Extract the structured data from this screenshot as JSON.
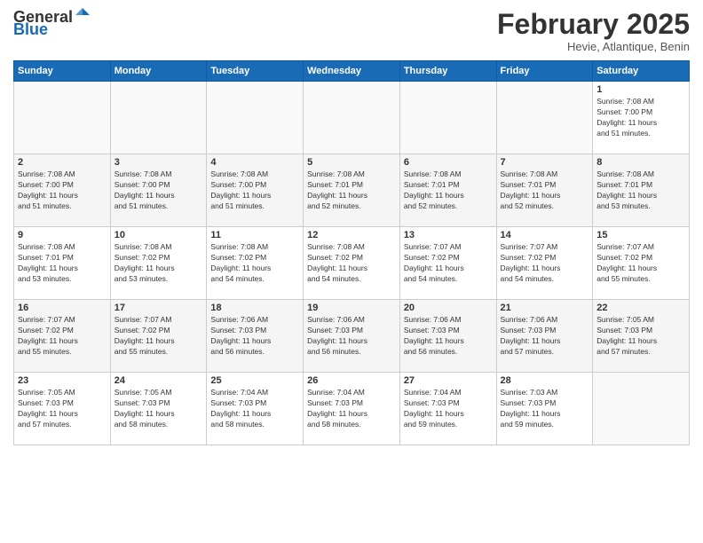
{
  "header": {
    "logo_general": "General",
    "logo_blue": "Blue",
    "month_title": "February 2025",
    "location": "Hevie, Atlantique, Benin"
  },
  "days_of_week": [
    "Sunday",
    "Monday",
    "Tuesday",
    "Wednesday",
    "Thursday",
    "Friday",
    "Saturday"
  ],
  "weeks": [
    [
      {
        "day": "",
        "info": ""
      },
      {
        "day": "",
        "info": ""
      },
      {
        "day": "",
        "info": ""
      },
      {
        "day": "",
        "info": ""
      },
      {
        "day": "",
        "info": ""
      },
      {
        "day": "",
        "info": ""
      },
      {
        "day": "1",
        "info": "Sunrise: 7:08 AM\nSunset: 7:00 PM\nDaylight: 11 hours\nand 51 minutes."
      }
    ],
    [
      {
        "day": "2",
        "info": "Sunrise: 7:08 AM\nSunset: 7:00 PM\nDaylight: 11 hours\nand 51 minutes."
      },
      {
        "day": "3",
        "info": "Sunrise: 7:08 AM\nSunset: 7:00 PM\nDaylight: 11 hours\nand 51 minutes."
      },
      {
        "day": "4",
        "info": "Sunrise: 7:08 AM\nSunset: 7:00 PM\nDaylight: 11 hours\nand 51 minutes."
      },
      {
        "day": "5",
        "info": "Sunrise: 7:08 AM\nSunset: 7:01 PM\nDaylight: 11 hours\nand 52 minutes."
      },
      {
        "day": "6",
        "info": "Sunrise: 7:08 AM\nSunset: 7:01 PM\nDaylight: 11 hours\nand 52 minutes."
      },
      {
        "day": "7",
        "info": "Sunrise: 7:08 AM\nSunset: 7:01 PM\nDaylight: 11 hours\nand 52 minutes."
      },
      {
        "day": "8",
        "info": "Sunrise: 7:08 AM\nSunset: 7:01 PM\nDaylight: 11 hours\nand 53 minutes."
      }
    ],
    [
      {
        "day": "9",
        "info": "Sunrise: 7:08 AM\nSunset: 7:01 PM\nDaylight: 11 hours\nand 53 minutes."
      },
      {
        "day": "10",
        "info": "Sunrise: 7:08 AM\nSunset: 7:02 PM\nDaylight: 11 hours\nand 53 minutes."
      },
      {
        "day": "11",
        "info": "Sunrise: 7:08 AM\nSunset: 7:02 PM\nDaylight: 11 hours\nand 54 minutes."
      },
      {
        "day": "12",
        "info": "Sunrise: 7:08 AM\nSunset: 7:02 PM\nDaylight: 11 hours\nand 54 minutes."
      },
      {
        "day": "13",
        "info": "Sunrise: 7:07 AM\nSunset: 7:02 PM\nDaylight: 11 hours\nand 54 minutes."
      },
      {
        "day": "14",
        "info": "Sunrise: 7:07 AM\nSunset: 7:02 PM\nDaylight: 11 hours\nand 54 minutes."
      },
      {
        "day": "15",
        "info": "Sunrise: 7:07 AM\nSunset: 7:02 PM\nDaylight: 11 hours\nand 55 minutes."
      }
    ],
    [
      {
        "day": "16",
        "info": "Sunrise: 7:07 AM\nSunset: 7:02 PM\nDaylight: 11 hours\nand 55 minutes."
      },
      {
        "day": "17",
        "info": "Sunrise: 7:07 AM\nSunset: 7:02 PM\nDaylight: 11 hours\nand 55 minutes."
      },
      {
        "day": "18",
        "info": "Sunrise: 7:06 AM\nSunset: 7:03 PM\nDaylight: 11 hours\nand 56 minutes."
      },
      {
        "day": "19",
        "info": "Sunrise: 7:06 AM\nSunset: 7:03 PM\nDaylight: 11 hours\nand 56 minutes."
      },
      {
        "day": "20",
        "info": "Sunrise: 7:06 AM\nSunset: 7:03 PM\nDaylight: 11 hours\nand 56 minutes."
      },
      {
        "day": "21",
        "info": "Sunrise: 7:06 AM\nSunset: 7:03 PM\nDaylight: 11 hours\nand 57 minutes."
      },
      {
        "day": "22",
        "info": "Sunrise: 7:05 AM\nSunset: 7:03 PM\nDaylight: 11 hours\nand 57 minutes."
      }
    ],
    [
      {
        "day": "23",
        "info": "Sunrise: 7:05 AM\nSunset: 7:03 PM\nDaylight: 11 hours\nand 57 minutes."
      },
      {
        "day": "24",
        "info": "Sunrise: 7:05 AM\nSunset: 7:03 PM\nDaylight: 11 hours\nand 58 minutes."
      },
      {
        "day": "25",
        "info": "Sunrise: 7:04 AM\nSunset: 7:03 PM\nDaylight: 11 hours\nand 58 minutes."
      },
      {
        "day": "26",
        "info": "Sunrise: 7:04 AM\nSunset: 7:03 PM\nDaylight: 11 hours\nand 58 minutes."
      },
      {
        "day": "27",
        "info": "Sunrise: 7:04 AM\nSunset: 7:03 PM\nDaylight: 11 hours\nand 59 minutes."
      },
      {
        "day": "28",
        "info": "Sunrise: 7:03 AM\nSunset: 7:03 PM\nDaylight: 11 hours\nand 59 minutes."
      },
      {
        "day": "",
        "info": ""
      }
    ]
  ]
}
